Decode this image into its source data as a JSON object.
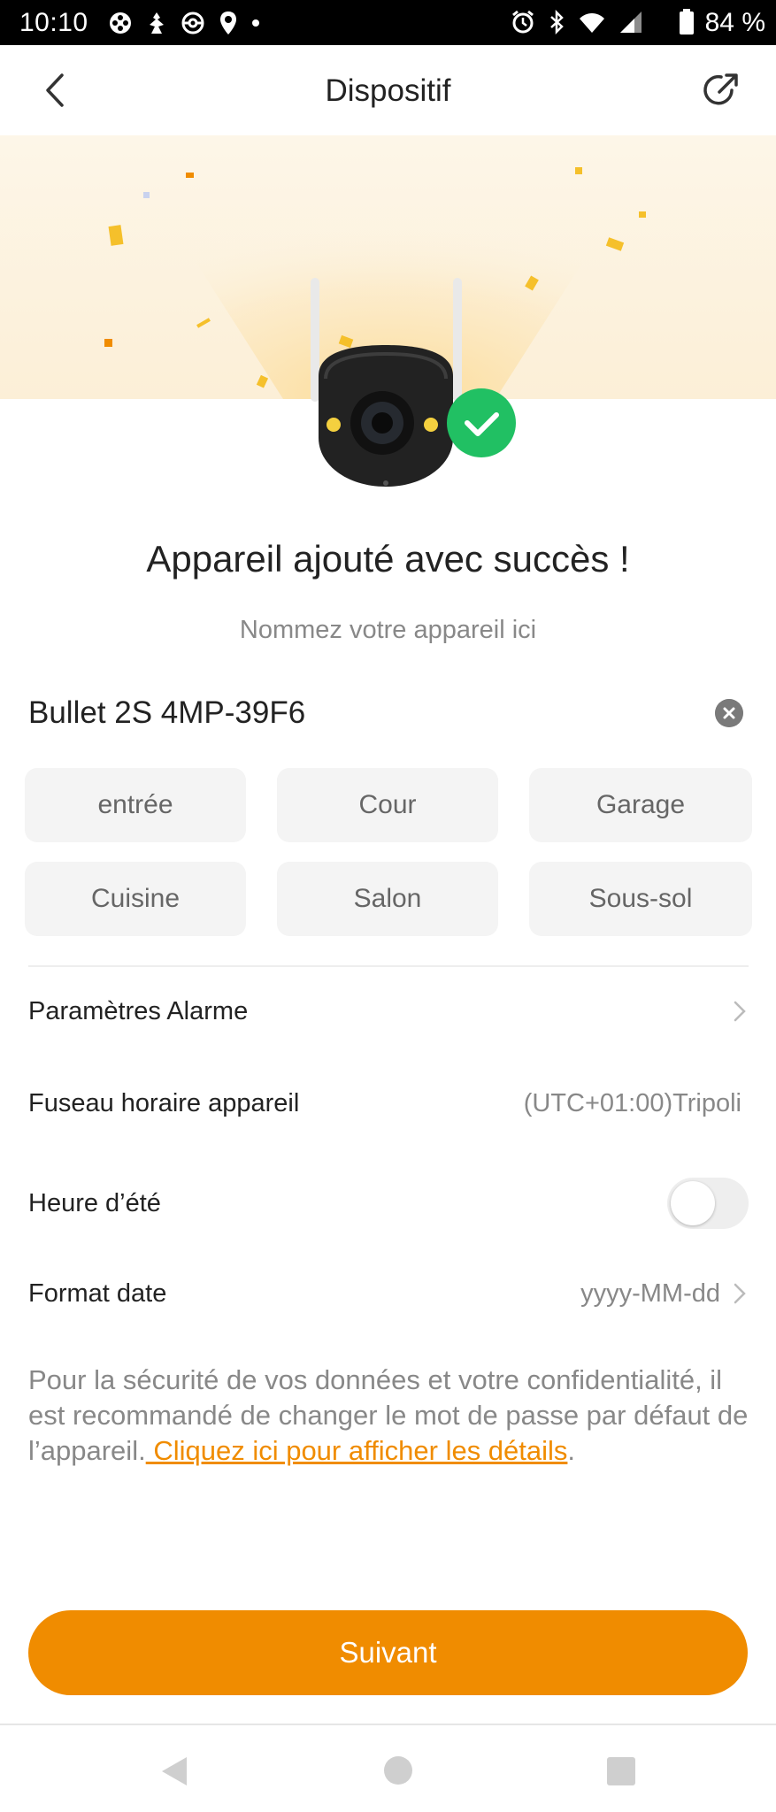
{
  "status_bar": {
    "time": "10:10",
    "battery": "84 %",
    "left_icons": [
      "game-controller-icon",
      "pokemon-icon",
      "pokeball-icon",
      "location-pin-icon",
      "dot-icon"
    ],
    "right_icons": [
      "alarm-icon",
      "bluetooth-icon",
      "wifi-icon",
      "signal-icon",
      "battery-icon"
    ]
  },
  "top_bar": {
    "title": "Dispositif",
    "back_icon": "chevron-left-icon",
    "share_icon": "external-link-icon"
  },
  "hero": {
    "success_badge_icon": "checkmark-icon",
    "accent_color": "#f08c00",
    "success_color": "#21c063"
  },
  "success_title": "Appareil ajouté avec succès !",
  "subtitle": "Nommez votre appareil ici",
  "device_name": {
    "value": "Bullet 2S 4MP-39F6",
    "clear_icon": "clear-icon"
  },
  "name_suggestions": [
    "entrée",
    "Cour",
    "Garage",
    "Cuisine",
    "Salon",
    "Sous-sol"
  ],
  "settings": {
    "alarm": {
      "label": "Paramètres Alarme"
    },
    "timezone": {
      "label": "Fuseau horaire appareil",
      "value": "(UTC+01:00)Tripoli"
    },
    "dst": {
      "label": "Heure d’été",
      "enabled": false
    },
    "date_format": {
      "label": "Format date",
      "value": "yyyy-MM-dd"
    }
  },
  "notice": {
    "text": "Pour la sécurité de vos données et votre confidentialité, il est recommandé de changer le mot de passe par défaut de l’appareil.",
    "link": " Cliquez ici pour afficher les détails",
    "end": "."
  },
  "next_button": "Suivant",
  "nav_bar": {
    "back_icon": "nav-back-icon",
    "home_icon": "nav-home-icon",
    "recents_icon": "nav-recents-icon"
  }
}
